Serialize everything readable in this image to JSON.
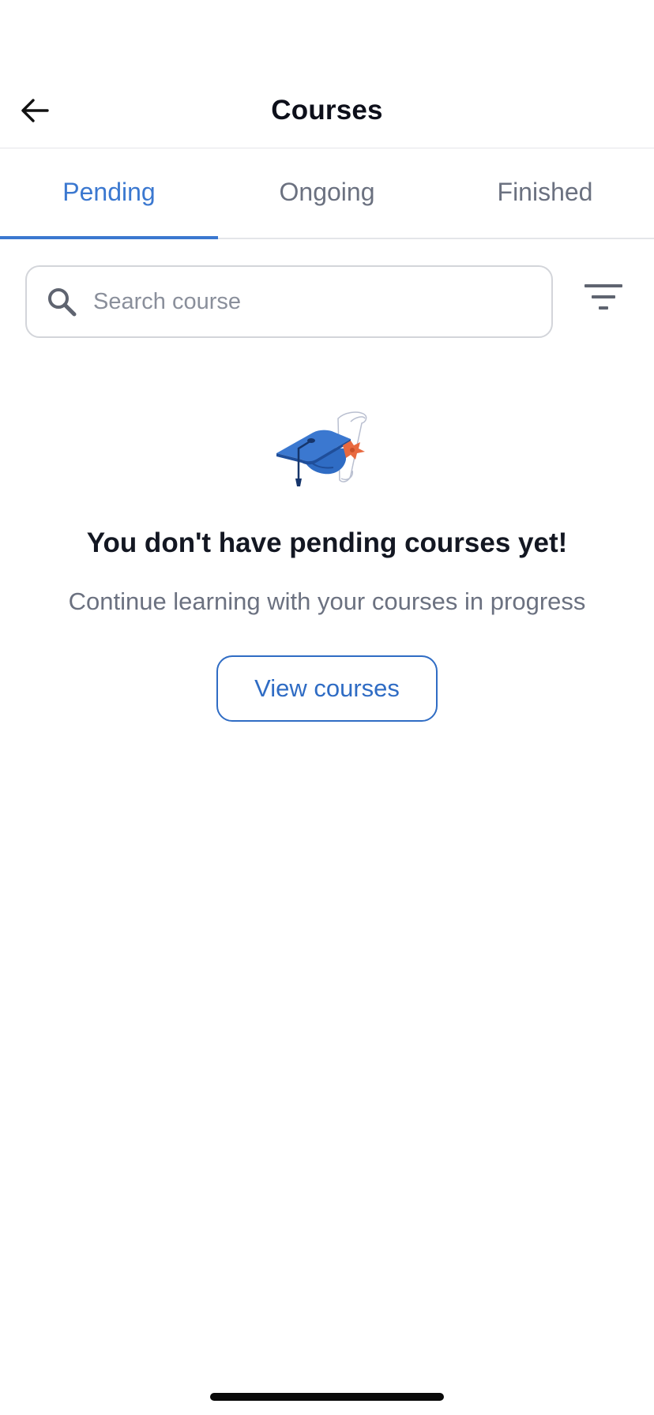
{
  "header": {
    "title": "Courses",
    "back_icon": "arrow-left-icon"
  },
  "tabs": [
    {
      "label": "Pending",
      "active": true
    },
    {
      "label": "Ongoing",
      "active": false
    },
    {
      "label": "Finished",
      "active": false
    }
  ],
  "search": {
    "placeholder": "Search course",
    "value": "",
    "icon": "search-icon"
  },
  "filter": {
    "icon": "filter-icon"
  },
  "empty_state": {
    "illustration": "graduation-cap-diploma-illustration",
    "title": "You don't have pending courses yet!",
    "subtitle": "Continue learning with your courses in progress",
    "button_label": "View courses"
  },
  "colors": {
    "accent": "#3b78d0",
    "text_primary": "#131722",
    "text_secondary": "#6b7180",
    "border": "#d3d5da"
  }
}
